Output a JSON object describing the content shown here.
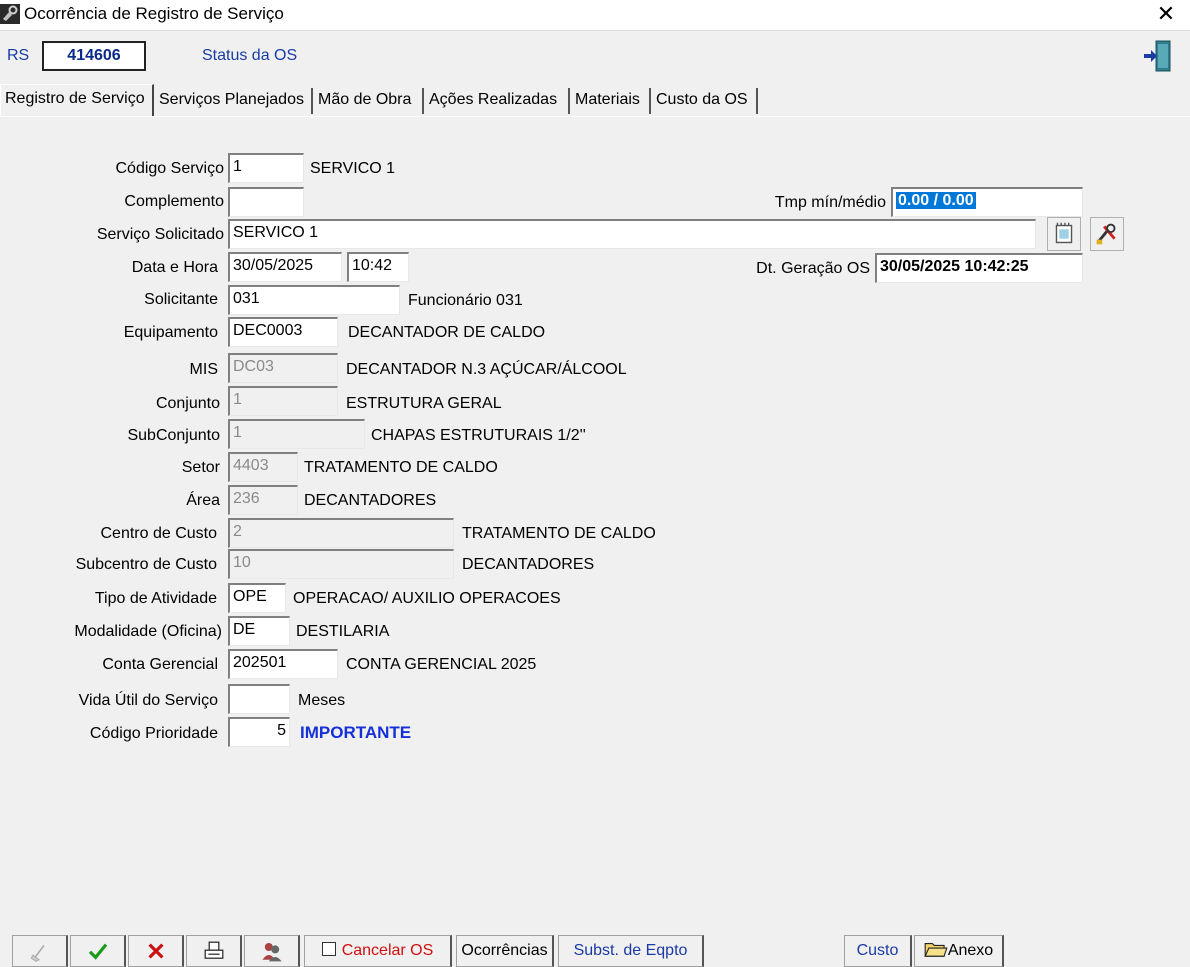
{
  "window": {
    "title": "Ocorrência de Registro de Serviço",
    "close_glyph": "✕"
  },
  "header": {
    "rs_label": "RS",
    "rs_number": "414606",
    "status_label": "Status da OS"
  },
  "tabs": [
    {
      "label": "Registro de Serviço"
    },
    {
      "label": "Serviços Planejados"
    },
    {
      "label": "Mão de Obra"
    },
    {
      "label": "Ações Realizadas"
    },
    {
      "label": "Materiais"
    },
    {
      "label": "Custo da OS"
    }
  ],
  "form": {
    "codigo_servico": {
      "label": "Código Serviço",
      "value": "1",
      "desc": "SERVICO 1"
    },
    "complemento": {
      "label": "Complemento",
      "value": ""
    },
    "tmp": {
      "label": "Tmp mín/médio",
      "value": "0.00 / 0.00"
    },
    "servico_solicitado": {
      "label": "Serviço Solicitado",
      "value": "SERVICO 1"
    },
    "data_hora": {
      "label": "Data e Hora",
      "date": "30/05/2025",
      "time": "10:42"
    },
    "dt_geracao": {
      "label": "Dt. Geração OS",
      "value": "30/05/2025 10:42:25"
    },
    "solicitante": {
      "label": "Solicitante",
      "value": "031",
      "desc": "Funcionário 031"
    },
    "equipamento": {
      "label": "Equipamento",
      "value": "DEC0003",
      "desc": "DECANTADOR DE CALDO"
    },
    "mis": {
      "label": "MIS",
      "value": "DC03",
      "desc": "DECANTADOR N.3 AÇÚCAR/ÁLCOOL"
    },
    "conjunto": {
      "label": "Conjunto",
      "value": "1",
      "desc": "ESTRUTURA GERAL"
    },
    "subconjunto": {
      "label": "SubConjunto",
      "value": "1",
      "desc": "CHAPAS ESTRUTURAIS 1/2''"
    },
    "setor": {
      "label": "Setor",
      "value": "4403",
      "desc": "TRATAMENTO DE CALDO"
    },
    "area": {
      "label": "Área",
      "value": "236",
      "desc": "DECANTADORES"
    },
    "centro_custo": {
      "label": "Centro de Custo",
      "value": "2",
      "desc": "TRATAMENTO DE CALDO"
    },
    "subcentro_custo": {
      "label": "Subcentro de Custo",
      "value": "10",
      "desc": "DECANTADORES"
    },
    "tipo_atividade": {
      "label": "Tipo de Atividade",
      "value": "OPE",
      "desc": "OPERACAO/ AUXILIO OPERACOES"
    },
    "modalidade": {
      "label": "Modalidade (Oficina)",
      "value": "DE",
      "desc": "DESTILARIA"
    },
    "conta_gerencial": {
      "label": "Conta Gerencial",
      "value": "202501",
      "desc": "CONTA GERENCIAL 2025"
    },
    "vida_util": {
      "label": "Vida Útil do Serviço",
      "value": "",
      "desc": "Meses"
    },
    "codigo_prioridade": {
      "label": "Código Prioridade",
      "value": "5",
      "desc": "IMPORTANTE"
    }
  },
  "toolbar": {
    "cancelar_os": "Cancelar OS",
    "ocorrencias": "Ocorrências",
    "subst_eqpto": "Subst. de Eqpto",
    "custo": "Custo",
    "anexo": "Anexo"
  },
  "colors": {
    "accent_blue": "#1a3aa5",
    "priority_blue": "#1530d8",
    "cancel_red": "#d01010",
    "selection": "#0078d7"
  }
}
